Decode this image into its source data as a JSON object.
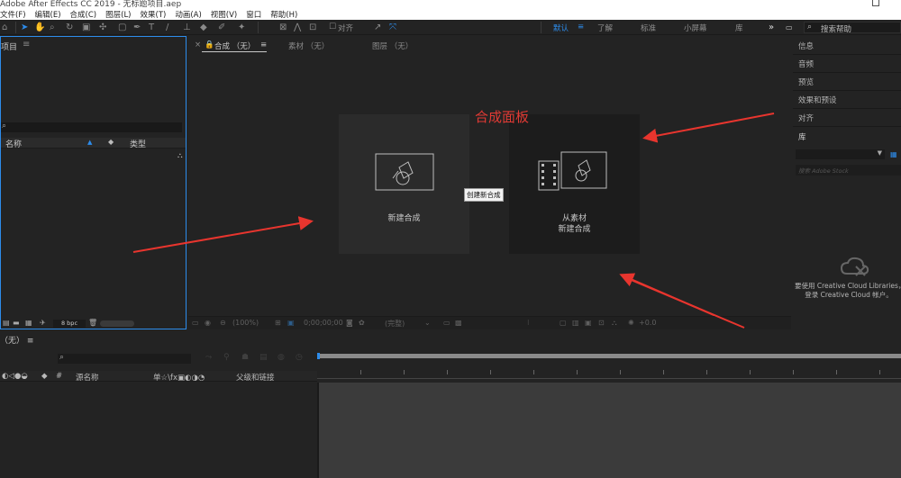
{
  "window": {
    "title": "Adobe After Effects CC 2019 - 无标题项目.aep"
  },
  "menubar": {
    "items": [
      "文件(F)",
      "编辑(E)",
      "合成(C)",
      "图层(L)",
      "效果(T)",
      "动画(A)",
      "视图(V)",
      "窗口",
      "帮助(H)"
    ]
  },
  "toolbar": {
    "align_label": "对齐",
    "workspaces": [
      "默认",
      "了解",
      "标准",
      "小屏幕",
      "库"
    ],
    "workspace_more": "»",
    "search_placeholder": "搜索帮助"
  },
  "project_panel": {
    "title": "项目",
    "search_icon": "⌕",
    "columns": [
      "名称",
      "类型"
    ],
    "bpc": "8 bpc"
  },
  "composition_panel": {
    "tabs": [
      {
        "label": "合成 （无）",
        "active": true
      },
      {
        "label": "素材 （无）",
        "active": false
      },
      {
        "label": "图层 （无）",
        "active": false
      }
    ],
    "new_comp_label": "新建合成",
    "from_footage_line1": "从素材",
    "from_footage_line2": "新建合成",
    "tooltip": "创建新合成",
    "annotation": "合成面板",
    "annotation_color": "#e23a34",
    "footer": {
      "zoom": "(100%)",
      "timecode": "0;00;00;00",
      "resolution": "(完整)",
      "exposure": "+0.0"
    }
  },
  "right_panels": {
    "items": [
      "信息",
      "音频",
      "预览",
      "效果和预设",
      "对齐"
    ],
    "library_title": "库",
    "stock_placeholder": "搜索 Adobe Stock",
    "cc_message_line1": "要使用 Creative Cloud Libraries，您",
    "cc_message_line2": "登录 Creative Cloud 帐户。"
  },
  "timeline": {
    "tab_label": "（无） ≡",
    "search_icon": "⌕",
    "source_name_header": "源名称",
    "switches_header": "单☆\\fx▣◐◑◔",
    "parent_header": "父级和链接"
  },
  "colors": {
    "accent": "#2d8ceb",
    "panel_bg": "#232323",
    "card_light": "#2b2b2b",
    "card_dark": "#1c1c1c"
  }
}
